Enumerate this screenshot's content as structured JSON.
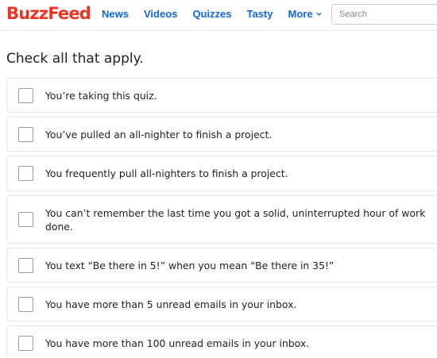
{
  "header": {
    "logo": "BuzzFeed",
    "nav": [
      "News",
      "Videos",
      "Quizzes",
      "Tasty",
      "More"
    ],
    "search_placeholder": "Search"
  },
  "quiz": {
    "question": "Check all that apply.",
    "options": [
      "You’re taking this quiz.",
      "You’ve pulled an all-nighter to finish a project.",
      "You frequently pull all-nighters to finish a project.",
      "You can’t remember the last time you got a solid, uninterrupted hour of work done.",
      "You text “Be there in 5!” when you mean “Be there in 35!”",
      "You have more than 5 unread emails in your inbox.",
      "You have more than 100 unread emails in your inbox."
    ]
  },
  "colors": {
    "brand": "#ee3322",
    "nav_link": "#0f65ef"
  },
  "icons": {
    "more": "chevron-down-icon"
  }
}
